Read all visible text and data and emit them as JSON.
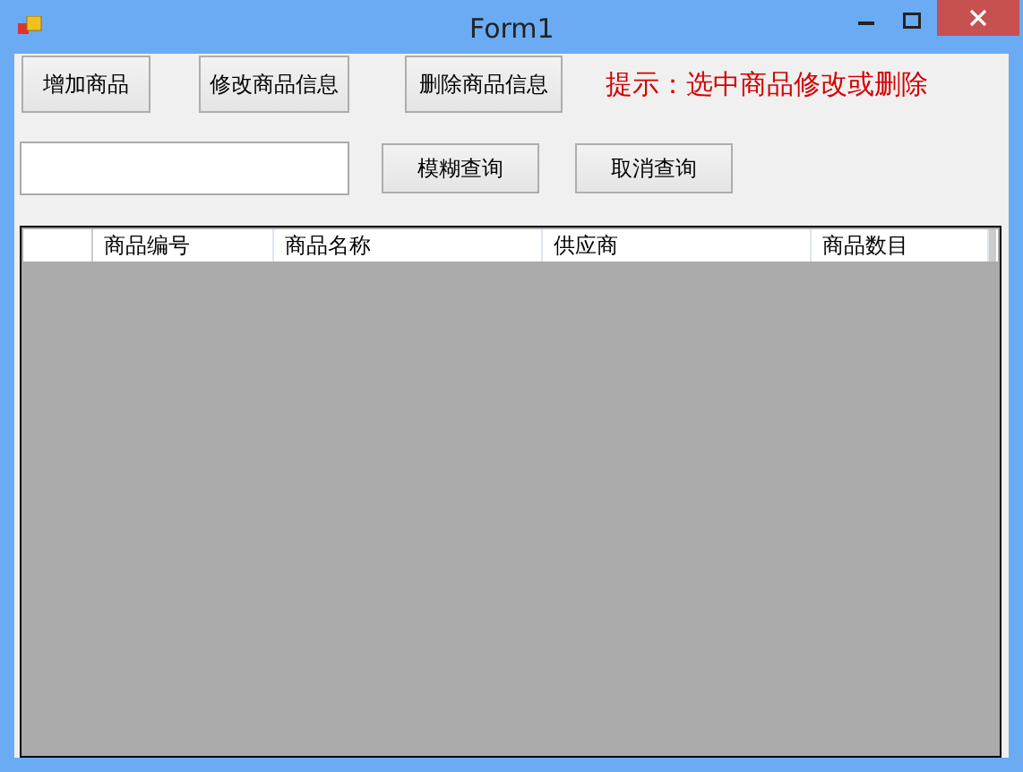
{
  "window": {
    "title": "Form1"
  },
  "toolbar_buttons": [
    "增加商品",
    "修改商品信息",
    "删除商品信息"
  ],
  "hint": "提示：选中商品修改或删除",
  "search_buttons": [
    "模糊查询",
    "取消查询"
  ],
  "table": {
    "columns": [
      "商品编号",
      "商品名称",
      "供应商",
      "商品数目"
    ]
  }
}
